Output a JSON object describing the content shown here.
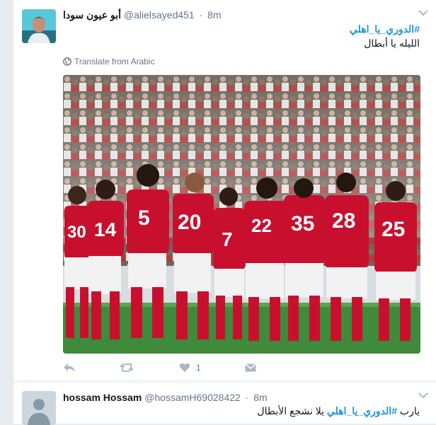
{
  "tweets": [
    {
      "fullname": "أبو عيون سودا",
      "screen_name": "@alielsayed451",
      "time": "8m",
      "hashtag": "#الدوري_يا_اهلي",
      "text": "الليله يا أبطال",
      "translate_label": "Translate from Arabic",
      "like_count": "1"
    },
    {
      "fullname": "hossam Hossam",
      "screen_name": "@hossamH69028422",
      "time": "8m",
      "text_prefix": "يارب",
      "hashtag": "#الدوري_يا_اهلي",
      "text_suffix": "يلا نشجع الأبطال"
    }
  ],
  "icons": {
    "reply": "reply-icon",
    "retweet": "retweet-icon",
    "like": "heart-icon",
    "dm": "envelope-icon",
    "menu": "chevron-down-icon",
    "translate": "globe-icon"
  },
  "colors": {
    "accent": "#1b95e0",
    "muted": "#657786",
    "icon": "#aab8c2"
  }
}
